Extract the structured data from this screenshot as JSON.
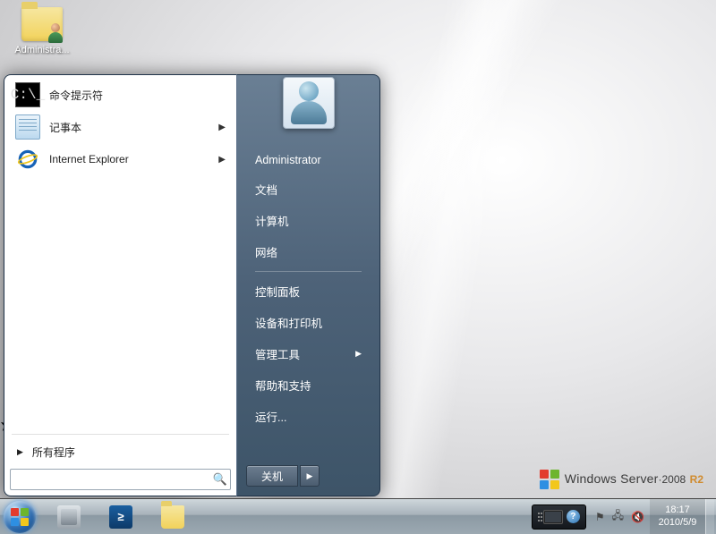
{
  "desktop": {
    "icons": [
      {
        "label": "Administra..."
      }
    ]
  },
  "start_menu": {
    "programs": [
      {
        "id": "cmd",
        "label": "命令提示符",
        "has_submenu": false
      },
      {
        "id": "notepad",
        "label": "记事本",
        "has_submenu": true
      },
      {
        "id": "ie",
        "label": "Internet Explorer",
        "has_submenu": true
      }
    ],
    "all_programs_label": "所有程序",
    "search_placeholder": "",
    "right": {
      "user": "Administrator",
      "items_top": [
        {
          "label": "文档"
        },
        {
          "label": "计算机"
        },
        {
          "label": "网络"
        }
      ],
      "items_mid": [
        {
          "label": "控制面板"
        },
        {
          "label": "设备和打印机"
        },
        {
          "label": "管理工具",
          "has_submenu": true
        },
        {
          "label": "帮助和支持"
        },
        {
          "label": "运行..."
        }
      ]
    },
    "shutdown_label": "关机"
  },
  "taskbar": {
    "pinned": [
      {
        "id": "server-manager",
        "title": "Server Manager"
      },
      {
        "id": "powershell",
        "title": "Windows PowerShell",
        "glyph": "≥"
      },
      {
        "id": "explorer",
        "title": "Windows Explorer"
      }
    ],
    "tray": {
      "language_bar": true,
      "icons": [
        {
          "id": "action-center",
          "glyph": "⚑"
        },
        {
          "id": "network",
          "glyph": "🖧"
        },
        {
          "id": "volume-muted",
          "glyph": "🔇"
        }
      ],
      "time": "18:17",
      "date": "2010/5/9"
    }
  },
  "watermark": {
    "product": "Windows Server",
    "version": "2008",
    "suffix": "R2"
  }
}
